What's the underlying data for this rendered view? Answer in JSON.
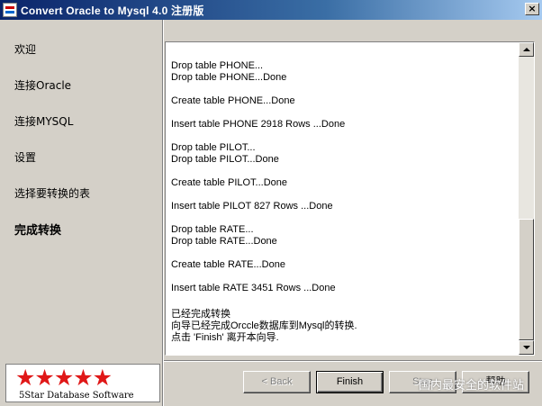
{
  "window": {
    "title": "Convert Oracle to Mysql 4.0 注册版",
    "close_label": "×"
  },
  "sidebar": {
    "items": [
      {
        "label": "欢迎"
      },
      {
        "label": "连接Oracle"
      },
      {
        "label": "连接MYSQL"
      },
      {
        "label": "设置"
      },
      {
        "label": "选择要转换的表"
      },
      {
        "label": "完成转换"
      }
    ],
    "active_index": 5
  },
  "log": {
    "lines": [
      "Drop table PHONE...",
      "Drop table PHONE...Done",
      "Create table PHONE...Done",
      "Insert table PHONE 2918 Rows ...Done",
      "Drop table PILOT...",
      "Drop table PILOT...Done",
      "Create table PILOT...Done",
      "Insert table PILOT 827 Rows ...Done",
      "Drop table RATE...",
      "Drop table RATE...Done",
      "Create table RATE...Done",
      "Insert table RATE 3451 Rows ...Done",
      "已经完成转换",
      "向导已经完成Orccle数据库到Mysql的转换.",
      "点击 'Finish' 离开本向导."
    ]
  },
  "logo": {
    "stars": "★★★★★",
    "text": "5Star Database Software"
  },
  "buttons": {
    "back": "< Back",
    "finish": "Finish",
    "stop": "Stop",
    "help": "帮助"
  },
  "watermark": {
    "text": "国内最安全的软件站"
  },
  "colors": {
    "titlebar_start": "#0a246a",
    "titlebar_end": "#a6caf0",
    "star_red": "#e01818",
    "face": "#d4d0c8"
  }
}
